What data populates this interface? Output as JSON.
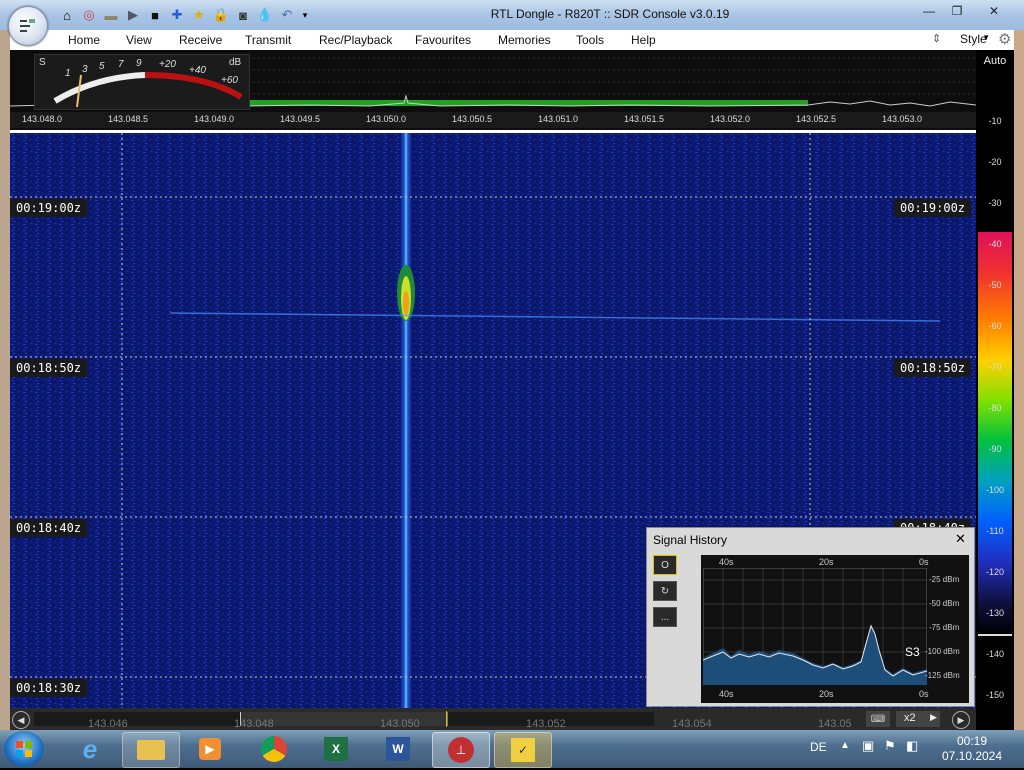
{
  "window": {
    "title": "RTL Dongle - R820T :: SDR Console v3.0.19"
  },
  "menu": {
    "items": [
      "Home",
      "View",
      "Receive",
      "Transmit",
      "Rec/Playback",
      "Favourites",
      "Memories",
      "Tools",
      "Help"
    ],
    "style_label": "Style"
  },
  "scale": {
    "auto_label": "Auto",
    "db_labels": [
      "-10",
      "-20",
      "-30",
      "-40",
      "-50",
      "-60",
      "-70",
      "-80",
      "-90",
      "-100",
      "-110",
      "-120",
      "-130",
      "-140",
      "-150"
    ]
  },
  "meter": {
    "s_label": "S",
    "db_label": "dB",
    "scale_labels": [
      "1",
      "3",
      "5",
      "7",
      "9",
      "+20",
      "+40",
      "+60"
    ]
  },
  "frequency_axis": [
    "143.048.0",
    "143.048.5",
    "143.049.0",
    "143.049.5",
    "143.050.0",
    "143.050.5",
    "143.051.0",
    "143.051.5",
    "143.052.0",
    "143.052.5",
    "143.053.0"
  ],
  "waterfall": {
    "time_labels": [
      "00:19:00z",
      "00:18:50z",
      "00:18:40z",
      "00:18:30z"
    ],
    "time_labels_right": [
      "00:19:00z",
      "00:18:50z",
      "00:18:40z"
    ]
  },
  "overview_axis": [
    "143.046",
    "143.048",
    "143.050",
    "143.052",
    "143.054",
    "143.05"
  ],
  "zoom": "x2",
  "signal_history": {
    "title": "Signal History",
    "top_labels": [
      "40s",
      "20s",
      "0s"
    ],
    "bottom_labels": [
      "40s",
      "20s",
      "0s"
    ],
    "dbm_labels": [
      "-25 dBm",
      "-50 dBm",
      "-75 dBm",
      "-100 dBm",
      "-125 dBm"
    ],
    "s_reading": "S3",
    "buttons": [
      "O",
      "↻",
      "..."
    ]
  },
  "taskbar": {
    "language": "DE",
    "time": "00:19",
    "date": "07.10.2024"
  },
  "colors": {
    "waterfall_bg": "#0a1a6e",
    "signal": "#2aa0ff",
    "title_bar": "#a9c4e4"
  }
}
